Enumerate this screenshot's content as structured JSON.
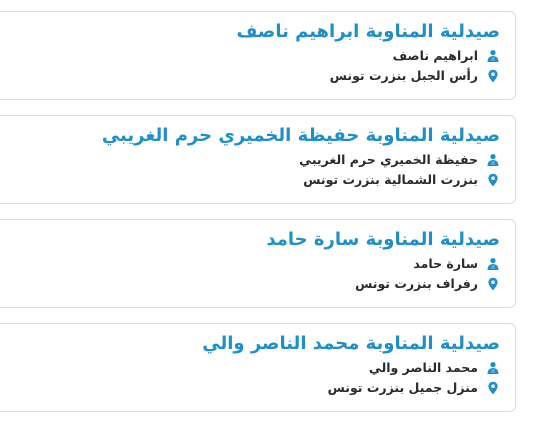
{
  "accent_color": "#1f8fc9",
  "pharmacies": [
    {
      "title": "صيدلية المناوبة ابراهيم ناصف",
      "owner": "ابراهيم ناصف",
      "address": "رأس الجبل بنزرت تونس"
    },
    {
      "title": "صيدلية المناوبة حفيظة الخميري حرم الغريبي",
      "owner": "حفيظة الخميري حرم الغريبي",
      "address": "بنزرت الشمالية بنزرت تونس"
    },
    {
      "title": "صيدلية المناوبة سارة حامد",
      "owner": "سارة حامد",
      "address": "رفراف بنزرت تونس"
    },
    {
      "title": "صيدلية المناوبة محمد الناصر والي",
      "owner": "محمد الناصر والي",
      "address": "منزل جميل بنزرت تونس"
    }
  ]
}
